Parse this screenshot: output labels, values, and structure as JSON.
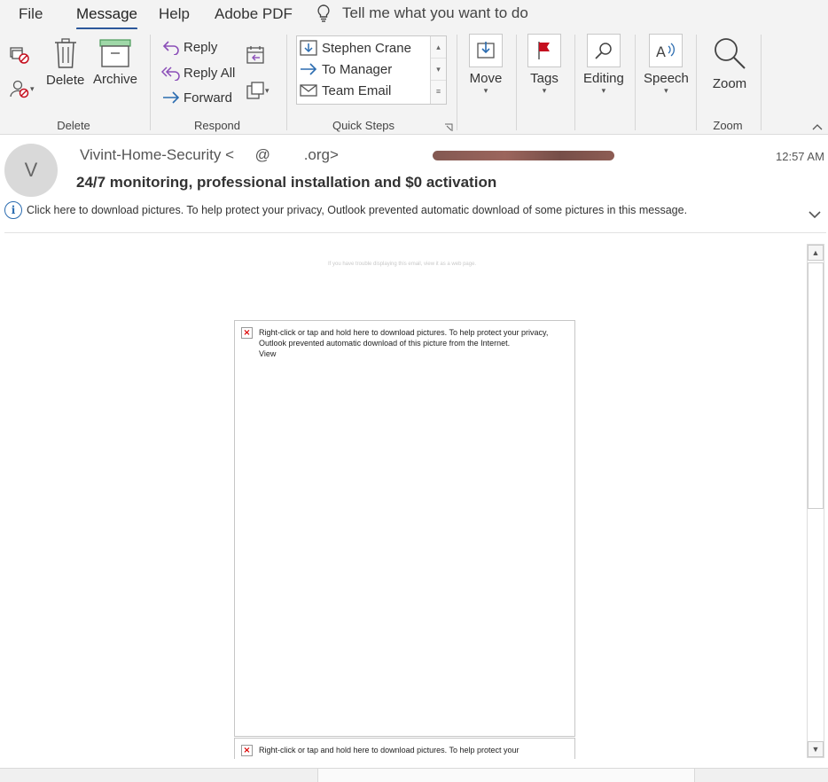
{
  "tabs": [
    "File",
    "Message",
    "Help",
    "Adobe PDF"
  ],
  "tell_me": "Tell me what you want to do",
  "ribbon": {
    "delete_group": {
      "delete": "Delete",
      "archive": "Archive",
      "label": "Delete"
    },
    "respond_group": {
      "reply": "Reply",
      "reply_all": "Reply All",
      "forward": "Forward",
      "label": "Respond"
    },
    "quick_steps": {
      "items": [
        "Stephen Crane",
        "To Manager",
        "Team Email"
      ],
      "label": "Quick Steps"
    },
    "move": "Move",
    "tags": "Tags",
    "editing": "Editing",
    "speech": "Speech",
    "zoom": {
      "button": "Zoom",
      "label": "Zoom"
    }
  },
  "email": {
    "avatar_initial": "V",
    "sender": "Vivint-Home-Security <",
    "sender_email_fragments": [
      "@",
      ".org>"
    ],
    "time": "12:57 AM",
    "subject": "24/7 monitoring, professional installation and $0 activation",
    "info": "Click here to download pictures. To help protect your privacy, Outlook prevented automatic download of some pictures in this message.",
    "web_note": "If you have trouble displaying this email, view it as a web page.",
    "blocked_image_msg": "Right-click or tap and hold here to download pictures. To help protect your privacy, Outlook prevented automatic download of this picture from the Internet.",
    "blocked_image_view": "View",
    "blocked_image_msg2": "Right-click or tap and hold here to download pictures. To help protect your"
  },
  "colors": {
    "accent": "#2b579a",
    "flag": "#c50f1f",
    "reply_purple": "#8b4fb8"
  }
}
